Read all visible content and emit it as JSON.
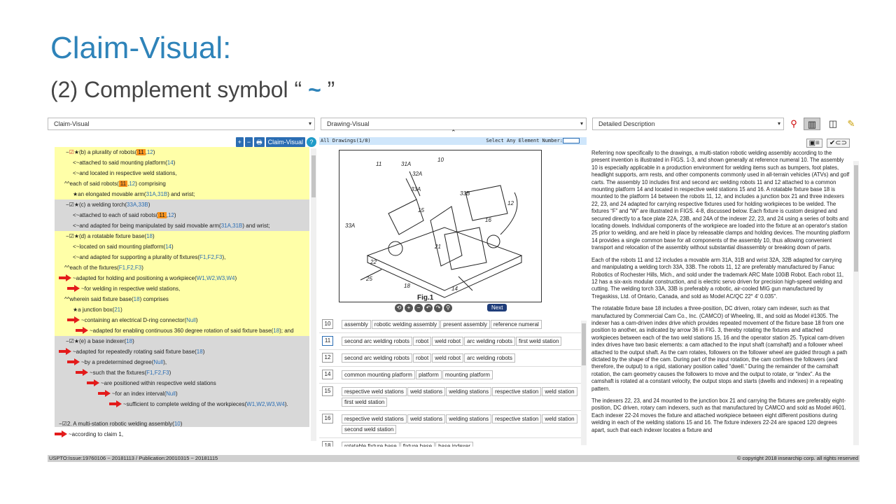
{
  "slide": {
    "title": "Claim-Visual:",
    "subtitle_pre": "(2) Complement symbol “",
    "subtitle_tilde": " ~ ",
    "subtitle_post": "”"
  },
  "toolbar": {
    "claim_select": "Claim-Visual",
    "drawing_select": "Drawing-Visual",
    "desc_select": "Detailed Description",
    "icons": [
      "search-icon",
      "grid-view-icon",
      "split-view-icon",
      "highlighter-icon"
    ]
  },
  "left": {
    "tools": [
      "+",
      "−",
      "🖶",
      "⊘",
      "Claim-Visual",
      "?"
    ],
    "claim2_label": "2. A multi-station robotic welding assembly(",
    "claim2_ref": "10",
    "claim2_close": ")",
    "claim2_sub": "~according to claim 1,"
  },
  "middle": {
    "header": "All Drawings(1/8)",
    "select_label": "Select Any Element Number:",
    "fig_label": "Fig.1",
    "next_label": "Next",
    "rows": [
      {
        "num": "10",
        "tags": [
          "assembly",
          "robotic welding assembly",
          "present assembly",
          "reference numeral"
        ]
      },
      {
        "num": "11",
        "tags": [
          "second arc welding robots",
          "robot",
          "weld robot",
          "arc welding robots",
          "first weld station"
        ]
      },
      {
        "num": "12",
        "tags": [
          "second arc welding robots",
          "robot",
          "weld robot",
          "arc welding robots"
        ]
      },
      {
        "num": "14",
        "tags": [
          "common mounting platform",
          "platform",
          "mounting platform"
        ]
      },
      {
        "num": "15",
        "tags": [
          "respective weld stations",
          "weld stations",
          "welding stations",
          "respective station",
          "weld station",
          "first weld station"
        ]
      },
      {
        "num": "16",
        "tags": [
          "respective weld stations",
          "weld stations",
          "welding stations",
          "respective station",
          "weld station",
          "second weld station"
        ]
      },
      {
        "num": "18",
        "tags": [
          "rotatable fixture base",
          "fixture base",
          "base indexer"
        ]
      }
    ]
  },
  "right": {
    "p1": "Referring now specifically to the drawings, a multi-station robotic welding assembly according to the present invention is illustrated in FIGS. 1-3, and shown generally at reference numeral 10. The assembly 10 is especially applicable in a production environment for welding items such as bumpers, foot plates, headlight supports, arm rests, and other components commonly used in all-terrain vehicles (ATVs) and golf carts. The assembly 10 includes first and second arc welding robots 11 and 12 attached to a common mounting platform 14 and located in respective weld stations 15 and 16. A rotatable fixture base 18 is mounted to the platform 14 between the robots 11, 12, and includes a junction box 21 and three indexers 22, 23, and 24 adapted for carrying respective fixtures used for holding workpieces to be welded. The fixtures “F” and “W” are illustrated in FIGS. 4-8, discussed below. Each fixture is custom designed and secured directly to a face plate 22A, 23B, and 24A of the indexer 22, 23, and 24 using a series of bolts and locating dowels. Individual components of the workpiece are loaded into the fixture at an operator's station 25 prior to welding, and are held in place by releasable clamps and holding devices. The mounting platform 14 provides a single common base for all components of the assembly 10, thus allowing convenient transport and relocation of the assembly without substantial disassembly or breaking down of parts.",
    "p2": "Each of the robots 11 and 12 includes a movable arm 31A, 31B and wrist 32A, 32B adapted for carrying and manipulating a welding torch 33A, 33B. The robots 11, 12 are preferably manufactured by Fanuc Robotics of Rochester Hills, Mich., and sold under the trademark ARC Mate 100iB Robot. Each robot 11, 12 has a six-axis modular construction, and is electric servo driven for precision high-speed welding and cutting. The welding torch 33A, 33B is preferably a robotic, air-cooled MIG gun manufactured by Tregaskiss, Ltd. of Ontario, Canada, and sold as Model AC/QC 22° 4' 0.035\".",
    "p3": "The rotatable fixture base 18 includes a three-position, DC driven, rotary cam indexer, such as that manufactured by Commercial Cam Co., Inc. (CAMCO) of Wheeling, Ill., and sold as Model #1305. The indexer has a cam-driven index drive which provides repeated movement of the fixture base 18 from one position to another, as indicated by arrow 36 in FIG. 3, thereby rotating the fixtures and attached workpieces between each of the two weld stations 15, 16 and the operator station 25. Typical cam-driven index drives have two basic elements: a cam attached to the input shaft (camshaft) and a follower wheel attached to the output shaft. As the cam rotates, followers on the follower wheel are guided through a path dictated by the shape of the cam. During part of the input rotation, the cam confines the followers (and therefore, the output) to a rigid, stationary position called “dwell.” During the remainder of the camshaft rotation, the cam geometry causes the followers to move and the output to rotate, or “index”. As the camshaft is rotated at a constant velocity, the output stops and starts (dwells and indexes) in a repeating pattern.",
    "p4": "The indexers 22, 23, and 24 mounted to the junction box 21 and carrying the fixtures are preferably eight-position, DC driven, rotary cam indexers, such as that manufactured by CAMCO and sold as Model #601. Each indexer 22-24 moves the fixture and attached workpiece between eight different positions during welding in each of the welding stations 15 and 16. The fixture indexers 22-24 are spaced 120 degrees apart, such that each indexer locates a fixture and"
  },
  "status": {
    "left": "USPTO:Issue:19760106 ~ 20181113 / Publication:20010315 ~ 20181115",
    "right": "© copyright 2018 insearchip corp. all rights reserved"
  }
}
